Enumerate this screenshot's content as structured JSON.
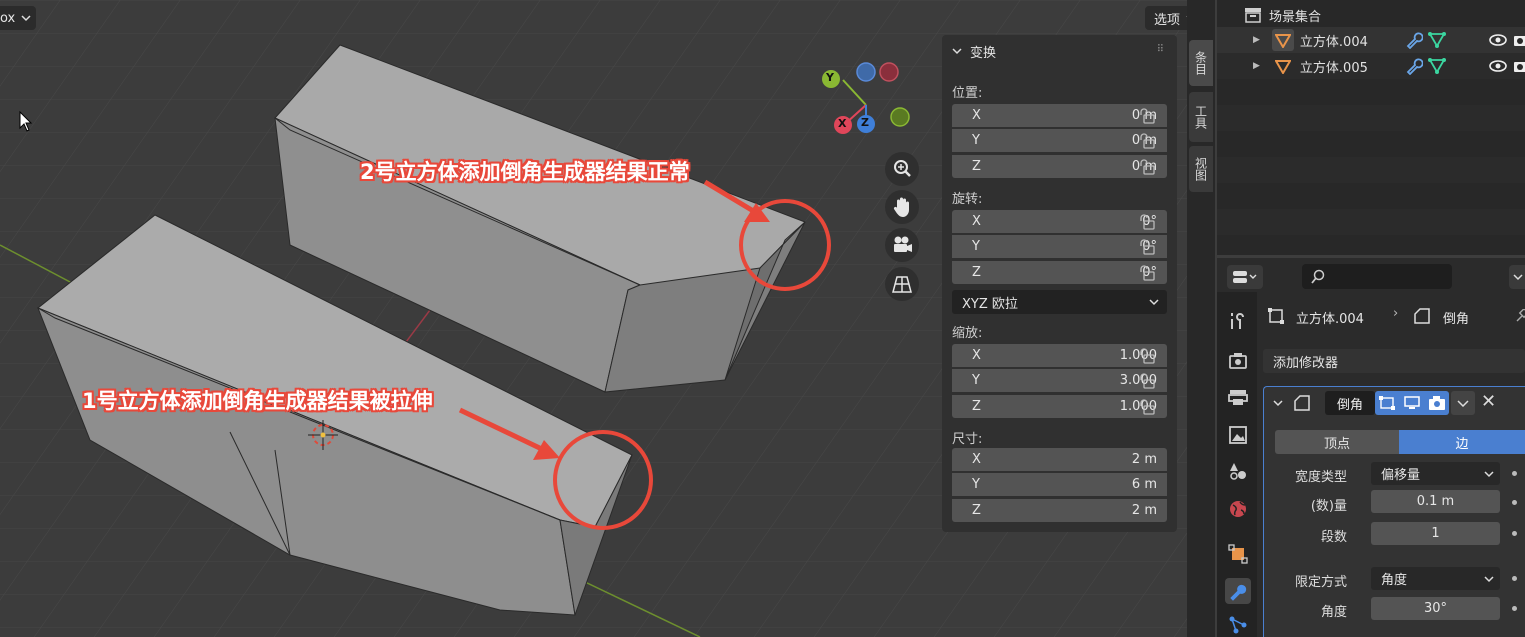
{
  "viewport": {
    "mode_fragment": "ox",
    "options_label": "选项",
    "annotation_top": "2号立方体添加倒角生成器结果正常",
    "annotation_bottom": "1号立方体添加倒角生成器结果被拉伸",
    "gizmo": {
      "y_label": "Y",
      "x_label": "X",
      "z_label": "Z"
    },
    "colors": {
      "annotation": "#e8483a",
      "axis_x": "#e0465a",
      "axis_y": "#8ab833",
      "axis_z": "#3f7fd8"
    }
  },
  "sidebar": {
    "tabs": [
      "条目",
      "工具",
      "视图"
    ],
    "transform": {
      "title": "变换",
      "location_label": "位置:",
      "location": [
        {
          "axis": "X",
          "value": "0 m"
        },
        {
          "axis": "Y",
          "value": "0 m"
        },
        {
          "axis": "Z",
          "value": "0 m"
        }
      ],
      "rotation_label": "旋转:",
      "rotation": [
        {
          "axis": "X",
          "value": "0°"
        },
        {
          "axis": "Y",
          "value": "0°"
        },
        {
          "axis": "Z",
          "value": "0°"
        }
      ],
      "rotation_mode": "XYZ 欧拉",
      "scale_label": "缩放:",
      "scale": [
        {
          "axis": "X",
          "value": "1.000"
        },
        {
          "axis": "Y",
          "value": "3.000"
        },
        {
          "axis": "Z",
          "value": "1.000"
        }
      ],
      "dimensions_label": "尺寸:",
      "dimensions": [
        {
          "axis": "X",
          "value": "2 m"
        },
        {
          "axis": "Y",
          "value": "6 m"
        },
        {
          "axis": "Z",
          "value": "2 m"
        }
      ]
    }
  },
  "outliner": {
    "collection": "场景集合",
    "items": [
      {
        "name": "立方体.004"
      },
      {
        "name": "立方体.005"
      }
    ]
  },
  "properties": {
    "object_name": "立方体.004",
    "modifier_breadcrumb": "倒角",
    "add_modifier": "添加修改器",
    "modifier": {
      "name": "倒角",
      "tab_vertices": "顶点",
      "tab_edges": "边",
      "width_type_label": "宽度类型",
      "width_type": "偏移量",
      "amount_label": "(数)量",
      "amount": "0.1 m",
      "segments_label": "段数",
      "segments": "1",
      "limit_method_label": "限定方式",
      "limit_method": "角度",
      "angle_label": "角度",
      "angle": "30°"
    }
  }
}
